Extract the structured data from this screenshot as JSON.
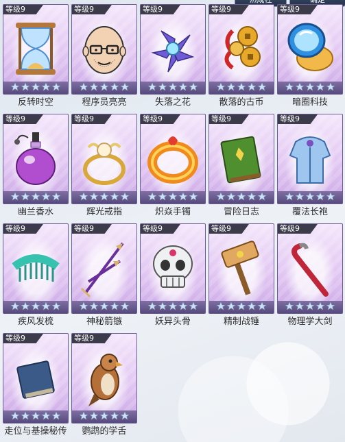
{
  "header": {
    "btn_left": "熟成社",
    "btn_right": "确定"
  },
  "level_text": "等级9",
  "star_count": 5,
  "cards": [
    {
      "name": "反转时空",
      "icon": "hourglass-icon"
    },
    {
      "name": "程序员亮亮",
      "icon": "bald-man-face-icon"
    },
    {
      "name": "失落之花",
      "icon": "crystal-flower-icon"
    },
    {
      "name": "散落的古币",
      "icon": "ancient-coins-icon"
    },
    {
      "name": "暗圈科技",
      "icon": "compact-mirror-icon"
    },
    {
      "name": "幽兰香水",
      "icon": "perfume-bottle-icon"
    },
    {
      "name": "辉光戒指",
      "icon": "pearl-ring-icon"
    },
    {
      "name": "炽焱手镯",
      "icon": "flame-bracelet-icon"
    },
    {
      "name": "冒险日志",
      "icon": "green-book-icon"
    },
    {
      "name": "覆法长袍",
      "icon": "blue-robe-icon"
    },
    {
      "name": "疾风发梳",
      "icon": "comb-icon"
    },
    {
      "name": "神秘箭镞",
      "icon": "crossed-arrows-icon"
    },
    {
      "name": "妖异头骨",
      "icon": "skull-icon"
    },
    {
      "name": "精制战锤",
      "icon": "war-hammer-icon"
    },
    {
      "name": "物理学大剑",
      "icon": "crowbar-icon"
    },
    {
      "name": "走位与基操秘传",
      "icon": "blue-book-icon"
    },
    {
      "name": "鹦鹉的学舌",
      "icon": "parrot-icon"
    }
  ]
}
